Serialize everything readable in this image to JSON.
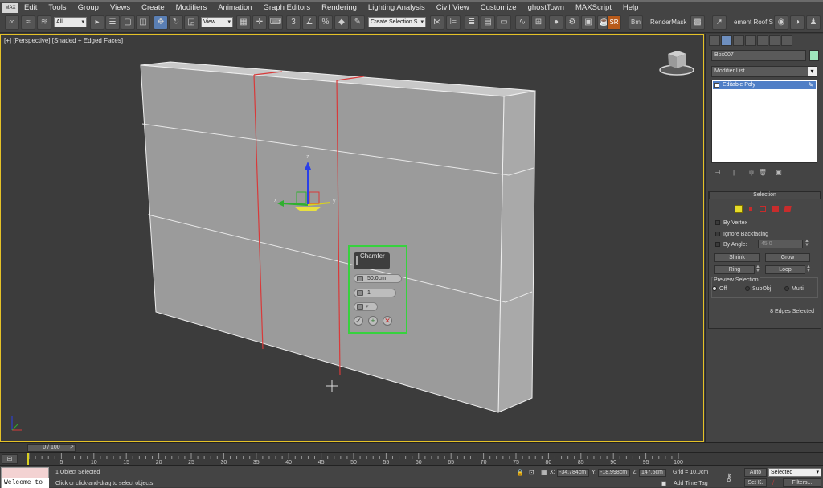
{
  "app": {
    "logo_text": "MAX"
  },
  "menu": [
    "Edit",
    "Tools",
    "Group",
    "Views",
    "Create",
    "Modifiers",
    "Animation",
    "Graph Editors",
    "Rendering",
    "Lighting Analysis",
    "Civil View",
    "Customize",
    "ghostTown",
    "MAXScript",
    "Help"
  ],
  "toolbar": {
    "selection_filter": "All",
    "reference_coord": "View",
    "named_selection": "Create Selection S",
    "sr_label": "SR",
    "bm_label": "Bm",
    "rendermask_label": "RenderMask",
    "element_label": "ement Roof S"
  },
  "viewport": {
    "label": "[+] [Perspective] [Shaded + Edged Faces]",
    "gizmo_axes": {
      "x": "x",
      "y": "y",
      "z": "z"
    }
  },
  "caddy": {
    "title": "Chamfer",
    "amount": "50.0cm",
    "segments": "1",
    "ok_icon": "check-icon",
    "apply_icon": "plus-icon",
    "cancel_icon": "cancel-icon"
  },
  "command_panel": {
    "object_name": "Box007",
    "object_color": "#9ee6bc",
    "modifier_list": "Modifier List",
    "stack_item": "Editable Poly",
    "selection": {
      "title": "Selection",
      "by_vertex": "By Vertex",
      "ignore_backfacing": "Ignore Backfacing",
      "by_angle": "By Angle:",
      "angle_value": "45.0",
      "shrink": "Shrink",
      "grow": "Grow",
      "ring": "Ring",
      "loop": "Loop",
      "preview_title": "Preview Selection",
      "preview_off": "Off",
      "preview_subobj": "SubObj",
      "preview_multi": "Multi",
      "edges_selected": "8 Edges Selected"
    }
  },
  "timeline": {
    "frame_display": "0 / 100",
    "next_btn": ">",
    "ticks": [
      "0",
      "5",
      "10",
      "15",
      "20",
      "25",
      "30",
      "35",
      "40",
      "45",
      "50",
      "55",
      "60",
      "65",
      "70",
      "75",
      "80",
      "85",
      "90",
      "95",
      "100"
    ]
  },
  "status": {
    "welcome": "Welcome to",
    "objects_selected": "1 Object Selected",
    "prompt": "Click or click-and-drag to select objects",
    "x_label": "X:",
    "x_value": "-34.784cm",
    "y_label": "Y:",
    "y_value": "-18.998cm",
    "z_label": "Z:",
    "z_value": "147.5cm",
    "grid": "Grid = 10.0cm",
    "add_time_tag": "Add Time Tag",
    "auto": "Auto",
    "set_k": "Set K.",
    "selected": "Selected",
    "filters": "Filters..."
  },
  "colors": {
    "viewport_border": "#e5c227",
    "caddy_border": "#37d23e",
    "selected_edge": "#d83a3a",
    "gizmo_z": "#2a3fe8",
    "gizmo_x": "#d8d020",
    "gizmo_y": "#2fb02f"
  }
}
